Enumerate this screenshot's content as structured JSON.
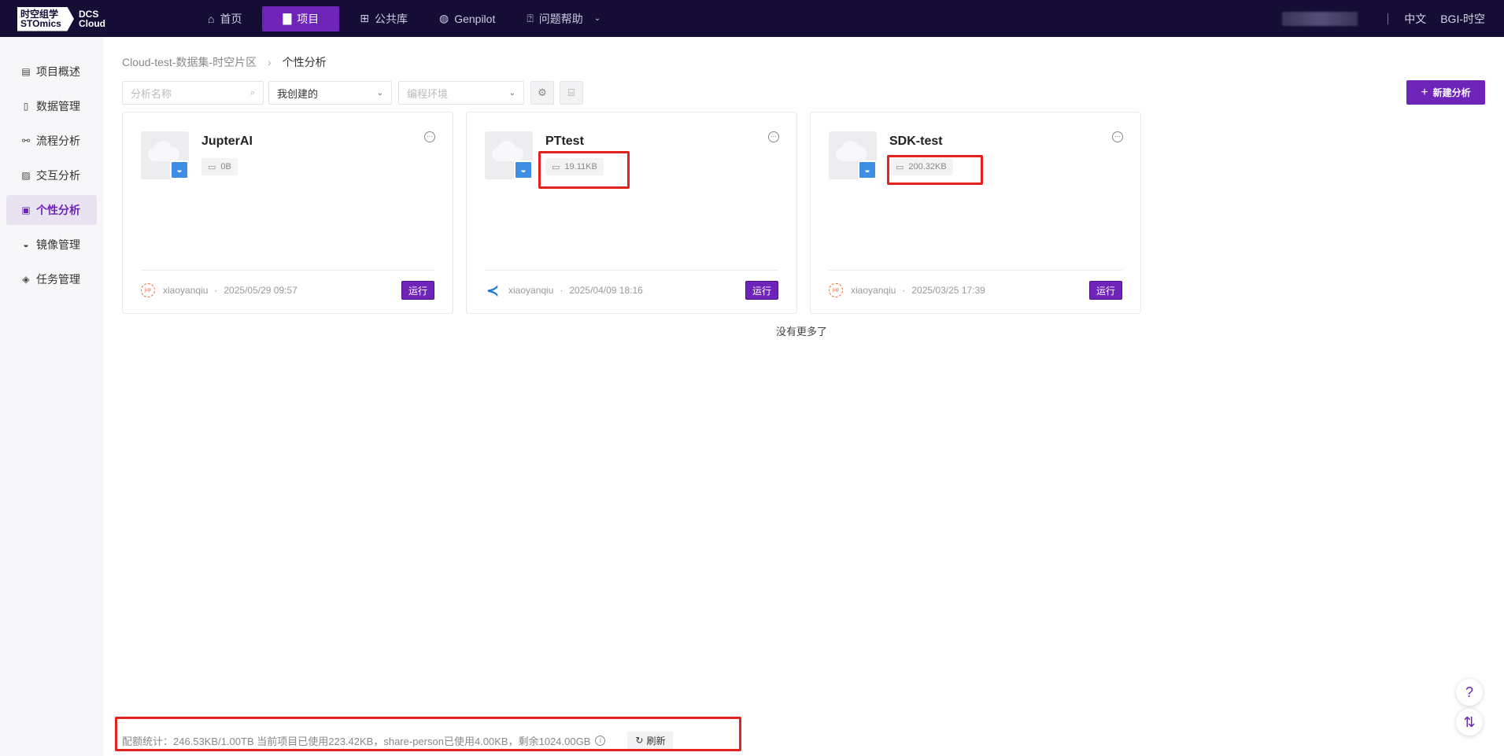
{
  "logo": {
    "cn_line1": "时空组学",
    "cn_line2": "STOmics",
    "en_line1": "DCS",
    "en_line2": "Cloud"
  },
  "nav": {
    "items": [
      {
        "label": "首页",
        "icon": "home-icon"
      },
      {
        "label": "项目",
        "icon": "document-icon"
      },
      {
        "label": "公共库",
        "icon": "grid-icon"
      },
      {
        "label": "Genpilot",
        "icon": "globe-icon"
      },
      {
        "label": "问题帮助",
        "icon": "question-icon"
      }
    ],
    "active_index": 1,
    "language": "中文",
    "user": "BGI-时空"
  },
  "sidebar": {
    "items": [
      {
        "label": "项目概述",
        "icon": "file-text-icon"
      },
      {
        "label": "数据管理",
        "icon": "file-search-icon"
      },
      {
        "label": "流程分析",
        "icon": "flow-icon"
      },
      {
        "label": "交互分析",
        "icon": "image-icon"
      },
      {
        "label": "个性分析",
        "icon": "chart-icon"
      },
      {
        "label": "镜像管理",
        "icon": "docker-icon"
      },
      {
        "label": "任务管理",
        "icon": "layers-icon"
      }
    ],
    "active_index": 4
  },
  "breadcrumb": {
    "parent": "Cloud-test-数据集-时空片区",
    "current": "个性分析"
  },
  "toolbar": {
    "search_placeholder": "分析名称",
    "creator_filter": "我创建的",
    "env_placeholder": "编程环境",
    "new_button": "新建分析"
  },
  "cards": [
    {
      "title": "JupterAI",
      "size": "0B",
      "user": "xiaoyanqiu",
      "time": "2025/05/29 09:57",
      "env": "jupyter",
      "run": "运行"
    },
    {
      "title": "PTtest",
      "size": "19.11KB",
      "user": "xiaoyanqiu",
      "time": "2025/04/09 18:16",
      "env": "vscode",
      "run": "运行"
    },
    {
      "title": "SDK-test",
      "size": "200.32KB",
      "user": "xiaoyanqiu",
      "time": "2025/03/25 17:39",
      "env": "jupyter",
      "run": "运行"
    }
  ],
  "no_more": "没有更多了",
  "quota": {
    "text": "配额统计：246.53KB/1.00TB  当前项目已使用223.42KB，share-person已使用4.00KB，剩余1024.00GB",
    "refresh": "刷新"
  },
  "colors": {
    "accent": "#6e24b8",
    "topbar": "#150d35",
    "highlight": "#e0231e"
  }
}
